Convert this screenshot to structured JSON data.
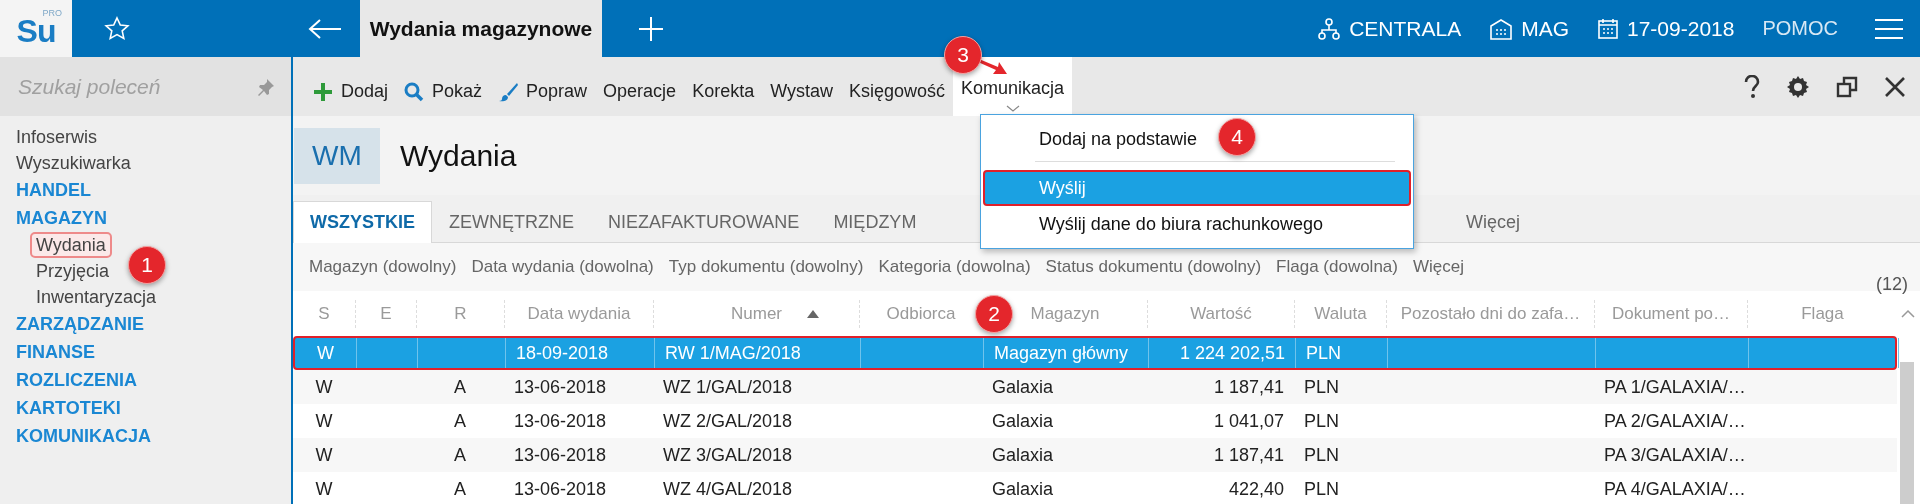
{
  "app_bar": {
    "logo": "Su",
    "logo_badge": "PRO",
    "tab_title": "Wydania magazynowe",
    "context": [
      {
        "kind": "branch",
        "label": "CENTRALA"
      },
      {
        "kind": "warehouse",
        "label": "MAG"
      },
      {
        "kind": "date",
        "label": "17-09-2018"
      }
    ],
    "help": "POMOC"
  },
  "sidebar": {
    "search_placeholder": "Szukaj poleceń",
    "items": [
      {
        "label": "Infoserwis",
        "kind": "link"
      },
      {
        "label": "Wyszukiwarka",
        "kind": "link"
      },
      {
        "label": "HANDEL",
        "kind": "section"
      },
      {
        "label": "MAGAZYN",
        "kind": "section",
        "children": [
          {
            "label": "Wydania",
            "selected": true
          },
          {
            "label": "Przyjęcia",
            "selected": false
          },
          {
            "label": "Inwentaryzacja",
            "selected": false
          }
        ]
      },
      {
        "label": "ZARZĄDZANIE",
        "kind": "section"
      },
      {
        "label": "FINANSE",
        "kind": "section"
      },
      {
        "label": "ROZLICZENIA",
        "kind": "section"
      },
      {
        "label": "KARTOTEKI",
        "kind": "section"
      },
      {
        "label": "KOMUNIKACJA",
        "kind": "section"
      }
    ]
  },
  "toolbar": {
    "actions": [
      {
        "label": "Dodaj",
        "kind": "plus",
        "expanded": false
      },
      {
        "label": "Pokaż",
        "kind": "search",
        "expanded": false
      },
      {
        "label": "Popraw",
        "kind": "brush",
        "expanded": false
      },
      {
        "label": "Operacje",
        "expanded": false
      },
      {
        "label": "Korekta",
        "expanded": false
      },
      {
        "label": "Wystaw",
        "expanded": false
      },
      {
        "label": "Księgowość",
        "expanded": false
      },
      {
        "label": "Komunikacja",
        "expanded": true
      }
    ]
  },
  "page": {
    "badge": "WM",
    "title": "Wydania"
  },
  "tabs": [
    {
      "label": "WSZYSTKIE",
      "selected": true
    },
    {
      "label": "ZEWNĘTRZNE",
      "selected": false
    },
    {
      "label": "NIEZAFAKTUROWANE",
      "selected": false
    },
    {
      "label": "MIĘDZYM",
      "selected": false
    }
  ],
  "more_tabs": "Więcej",
  "filters": [
    "Magazyn (dowolny)",
    "Data wydania (dowolna)",
    "Typ dokumentu (dowolny)",
    "Kategoria (dowolna)",
    "Status dokumentu (dowolny)",
    "Flaga (dowolna)",
    "Więcej"
  ],
  "count": "(12)",
  "table": {
    "columns": [
      {
        "label": "S",
        "sorted": false
      },
      {
        "label": "E",
        "sorted": false
      },
      {
        "label": "R",
        "sorted": false
      },
      {
        "label": "Data wydania",
        "sorted": false
      },
      {
        "label": "Numer",
        "sorted": true
      },
      {
        "label": "Odbiorca",
        "sorted": false
      },
      {
        "label": "Magazyn",
        "sorted": false
      },
      {
        "label": "Wartość",
        "sorted": false
      },
      {
        "label": "Waluta",
        "sorted": false
      },
      {
        "label": "Pozostało dni do zafa…",
        "sorted": false
      },
      {
        "label": "Dokument po…",
        "sorted": false
      },
      {
        "label": "Flaga",
        "sorted": false
      }
    ],
    "rows": [
      {
        "selected": true,
        "s": "W",
        "date": "18-09-2018",
        "number": "RW 1/MAG/2018",
        "warehouse": "Magazyn główny",
        "value": "1 224 202,51",
        "currency": "PLN"
      },
      {
        "selected": false,
        "s": "W",
        "r": "A",
        "date": "13-06-2018",
        "number": "WZ 1/GAL/2018",
        "warehouse": "Galaxia",
        "value": "1 187,41",
        "currency": "PLN",
        "document": "PA 1/GALAXIA/…"
      },
      {
        "selected": false,
        "s": "W",
        "r": "A",
        "date": "13-06-2018",
        "number": "WZ 2/GAL/2018",
        "warehouse": "Galaxia",
        "value": "1 041,07",
        "currency": "PLN",
        "document": "PA 2/GALAXIA/…"
      },
      {
        "selected": false,
        "s": "W",
        "r": "A",
        "date": "13-06-2018",
        "number": "WZ 3/GAL/2018",
        "warehouse": "Galaxia",
        "value": "1 187,41",
        "currency": "PLN",
        "document": "PA 3/GALAXIA/…"
      },
      {
        "selected": false,
        "s": "W",
        "r": "A",
        "date": "13-06-2018",
        "number": "WZ 4/GAL/2018",
        "warehouse": "Galaxia",
        "value": "422,40",
        "currency": "PLN",
        "document": "PA 4/GALAXIA/…"
      }
    ]
  },
  "menu": {
    "items": [
      {
        "kind": "item",
        "label": "Dodaj na podstawie",
        "selected": false
      },
      {
        "kind": "separator"
      },
      {
        "kind": "item",
        "label": "Wyślij",
        "selected": true
      },
      {
        "kind": "item",
        "label": "Wyślij dane do biura rachunkowego",
        "selected": false
      }
    ]
  },
  "annotations": [
    {
      "label": "1"
    },
    {
      "label": "2"
    },
    {
      "label": "3"
    },
    {
      "label": "4"
    }
  ]
}
